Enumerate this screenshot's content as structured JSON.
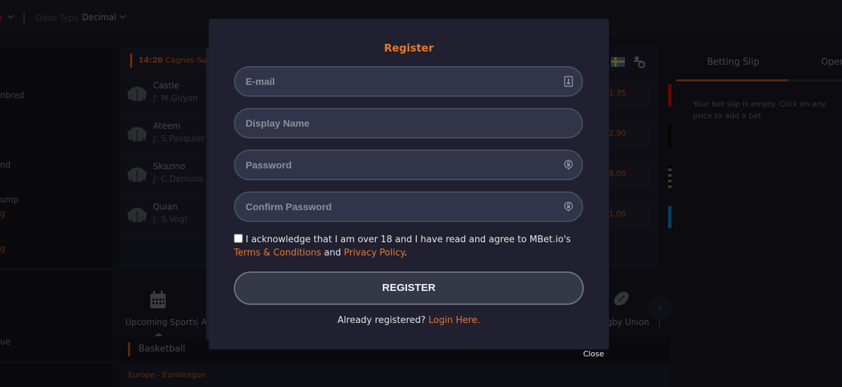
{
  "topbar": {
    "odds_type_label": "Odds Type",
    "odds_type_value": "Decimal"
  },
  "sidebar": {
    "items": [
      {
        "label": "nbred"
      },
      {
        "label": "nd"
      },
      {
        "label": "ump"
      },
      {
        "label": "ue"
      }
    ],
    "orange_marks": [
      "g",
      "g"
    ]
  },
  "race": {
    "time": "14:20",
    "venue": "Cagnes-Sur-",
    "runners": [
      {
        "name": "Castle",
        "jockey": "J: M.Guyon",
        "odds": "1.35",
        "silk_color": "#6a0a0a"
      },
      {
        "name": "Ateem",
        "jockey": "J: S.Pasquier",
        "odds": "2.90",
        "silk_color": "#050505"
      },
      {
        "name": "Skazino",
        "jockey": "J: C.Demuro",
        "odds": "8.00",
        "silk_color": "#3a3a3a"
      },
      {
        "name": "Quian",
        "jockey": "J: S.Vogt",
        "odds": "1.00",
        "silk_color": "#0a4a6a"
      }
    ]
  },
  "sports_bar": {
    "upcoming_label": "Upcoming Sports",
    "next_label": "Ar",
    "rugby_label": "gby Union",
    "next_arrow": "›"
  },
  "section": {
    "title": "Basketball",
    "league": "Europe - Euroleague"
  },
  "betting_slip": {
    "tab_active": "Betting Slip",
    "tab_other": "Open",
    "empty_message": "Your bet slip is empty. Click on any price to add a bet"
  },
  "modal": {
    "title": "Register",
    "fields": {
      "email_placeholder": "E-mail",
      "display_name_placeholder": "Display Name",
      "password_placeholder": "Password",
      "confirm_password_placeholder": "Confirm Password"
    },
    "consent": {
      "text_before": "I acknowledge that I am over 18 and I have read and agree to MBet.io's ",
      "terms_link": "Terms & Conditions",
      "and_text": " and ",
      "privacy_link": "Privacy Policy",
      "period": ".",
      "checked": false
    },
    "register_button": "REGISTER",
    "already_registered": "Already registered?",
    "login_link": "Login Here."
  },
  "close_label": "Close",
  "colors": {
    "accent": "#e6792e",
    "modal_bg": "#212031",
    "field_bg": "#32354a"
  }
}
